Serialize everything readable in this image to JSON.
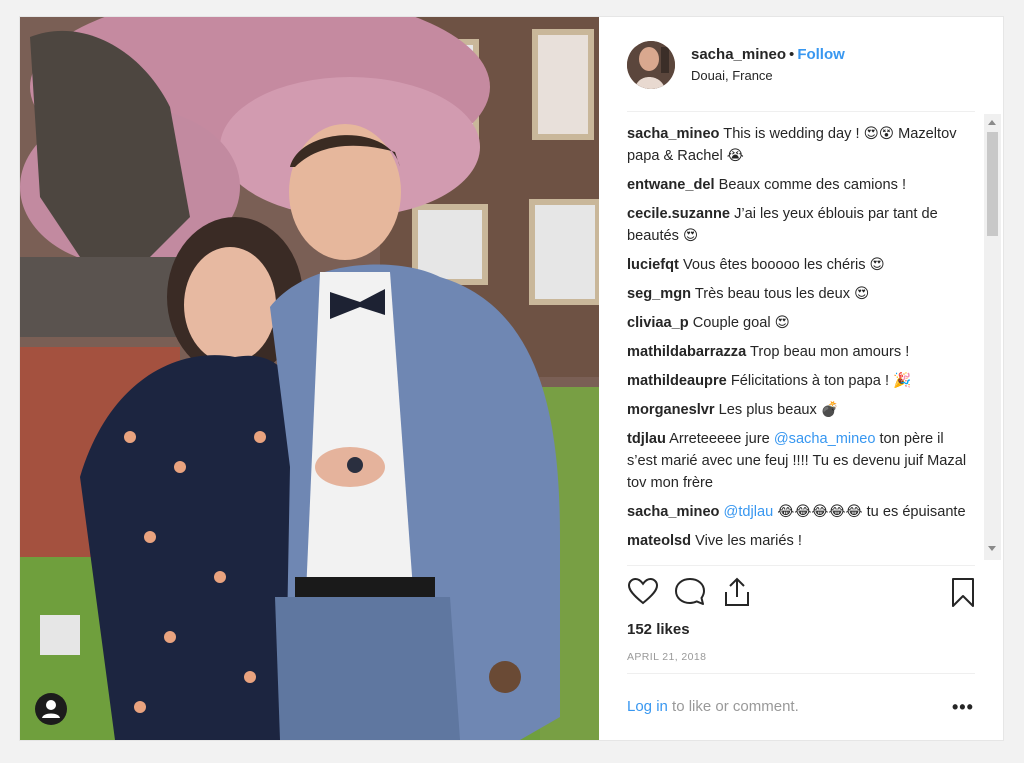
{
  "header": {
    "username": "sacha_mineo",
    "separator": "•",
    "follow_label": "Follow",
    "location": "Douai, France"
  },
  "comments": [
    {
      "user": "sacha_mineo",
      "text": "This is wedding day ! 😍😵 Mazeltov papa & Rachel 😭"
    },
    {
      "user": "entwane_del",
      "text": "Beaux comme des camions !"
    },
    {
      "user": "cecile.suzanne",
      "text": "J’ai les yeux éblouis par tant de beautés 😍"
    },
    {
      "user": "luciefqt",
      "text": "Vous êtes booooo les chéris 😍"
    },
    {
      "user": "seg_mgn",
      "text": "Très beau tous les deux 😍"
    },
    {
      "user": "cliviaa_p",
      "text": "Couple goal 😍"
    },
    {
      "user": "mathildabarrazza",
      "text": "Trop beau mon amours !"
    },
    {
      "user": "mathildeaupre",
      "text": "Félicitations à ton papa ! 🎉"
    },
    {
      "user": "morganeslvr",
      "text": "Les plus beaux 💣"
    },
    {
      "user": "tdjlau",
      "text_before": "Arreteeeee jure ",
      "mention": "@sacha_mineo",
      "text_after": " ton père il s’est marié avec une feuj !!!! Tu es devenu juif Mazal tov mon frère"
    },
    {
      "user": "sacha_mineo",
      "text_before": "",
      "mention": "@tdjlau",
      "text_after": " 😂😂😂😂😂 tu es épuisante"
    },
    {
      "user": "mateolsd",
      "text": "Vive les mariés !"
    }
  ],
  "actions": {
    "icons": [
      "heart-icon",
      "comment-icon",
      "share-icon",
      "bookmark-icon"
    ]
  },
  "likes": "152 likes",
  "date": "APRIL 21, 2018",
  "footer": {
    "login_link": "Log in",
    "login_rest": " to like or comment.",
    "more": "•••"
  },
  "colors": {
    "link": "#3897f0",
    "text": "#262626",
    "muted": "#999999"
  }
}
